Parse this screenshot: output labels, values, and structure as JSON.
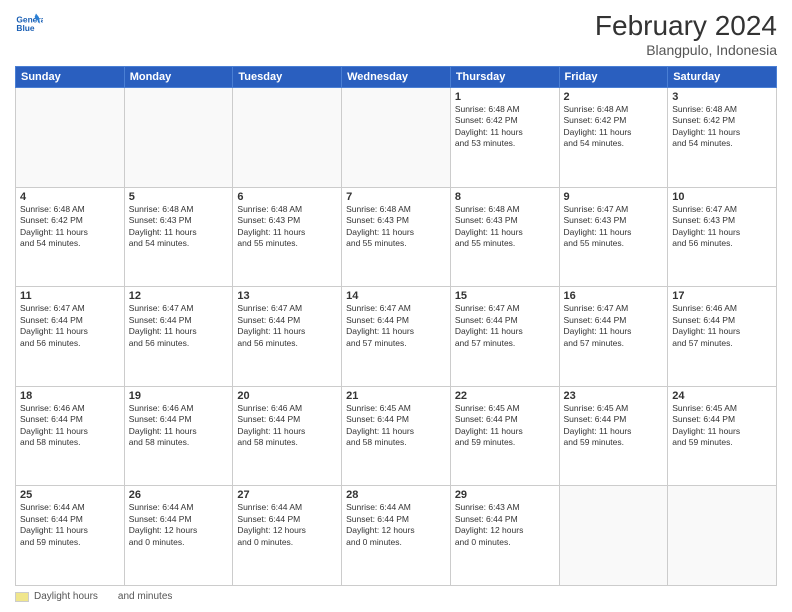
{
  "header": {
    "logo_line1": "General",
    "logo_line2": "Blue",
    "month_year": "February 2024",
    "location": "Blangpulo, Indonesia"
  },
  "days_of_week": [
    "Sunday",
    "Monday",
    "Tuesday",
    "Wednesday",
    "Thursday",
    "Friday",
    "Saturday"
  ],
  "weeks": [
    [
      {
        "day": "",
        "info": ""
      },
      {
        "day": "",
        "info": ""
      },
      {
        "day": "",
        "info": ""
      },
      {
        "day": "",
        "info": ""
      },
      {
        "day": "1",
        "info": "Sunrise: 6:48 AM\nSunset: 6:42 PM\nDaylight: 11 hours\nand 53 minutes."
      },
      {
        "day": "2",
        "info": "Sunrise: 6:48 AM\nSunset: 6:42 PM\nDaylight: 11 hours\nand 54 minutes."
      },
      {
        "day": "3",
        "info": "Sunrise: 6:48 AM\nSunset: 6:42 PM\nDaylight: 11 hours\nand 54 minutes."
      }
    ],
    [
      {
        "day": "4",
        "info": "Sunrise: 6:48 AM\nSunset: 6:42 PM\nDaylight: 11 hours\nand 54 minutes."
      },
      {
        "day": "5",
        "info": "Sunrise: 6:48 AM\nSunset: 6:43 PM\nDaylight: 11 hours\nand 54 minutes."
      },
      {
        "day": "6",
        "info": "Sunrise: 6:48 AM\nSunset: 6:43 PM\nDaylight: 11 hours\nand 55 minutes."
      },
      {
        "day": "7",
        "info": "Sunrise: 6:48 AM\nSunset: 6:43 PM\nDaylight: 11 hours\nand 55 minutes."
      },
      {
        "day": "8",
        "info": "Sunrise: 6:48 AM\nSunset: 6:43 PM\nDaylight: 11 hours\nand 55 minutes."
      },
      {
        "day": "9",
        "info": "Sunrise: 6:47 AM\nSunset: 6:43 PM\nDaylight: 11 hours\nand 55 minutes."
      },
      {
        "day": "10",
        "info": "Sunrise: 6:47 AM\nSunset: 6:43 PM\nDaylight: 11 hours\nand 56 minutes."
      }
    ],
    [
      {
        "day": "11",
        "info": "Sunrise: 6:47 AM\nSunset: 6:44 PM\nDaylight: 11 hours\nand 56 minutes."
      },
      {
        "day": "12",
        "info": "Sunrise: 6:47 AM\nSunset: 6:44 PM\nDaylight: 11 hours\nand 56 minutes."
      },
      {
        "day": "13",
        "info": "Sunrise: 6:47 AM\nSunset: 6:44 PM\nDaylight: 11 hours\nand 56 minutes."
      },
      {
        "day": "14",
        "info": "Sunrise: 6:47 AM\nSunset: 6:44 PM\nDaylight: 11 hours\nand 57 minutes."
      },
      {
        "day": "15",
        "info": "Sunrise: 6:47 AM\nSunset: 6:44 PM\nDaylight: 11 hours\nand 57 minutes."
      },
      {
        "day": "16",
        "info": "Sunrise: 6:47 AM\nSunset: 6:44 PM\nDaylight: 11 hours\nand 57 minutes."
      },
      {
        "day": "17",
        "info": "Sunrise: 6:46 AM\nSunset: 6:44 PM\nDaylight: 11 hours\nand 57 minutes."
      }
    ],
    [
      {
        "day": "18",
        "info": "Sunrise: 6:46 AM\nSunset: 6:44 PM\nDaylight: 11 hours\nand 58 minutes."
      },
      {
        "day": "19",
        "info": "Sunrise: 6:46 AM\nSunset: 6:44 PM\nDaylight: 11 hours\nand 58 minutes."
      },
      {
        "day": "20",
        "info": "Sunrise: 6:46 AM\nSunset: 6:44 PM\nDaylight: 11 hours\nand 58 minutes."
      },
      {
        "day": "21",
        "info": "Sunrise: 6:45 AM\nSunset: 6:44 PM\nDaylight: 11 hours\nand 58 minutes."
      },
      {
        "day": "22",
        "info": "Sunrise: 6:45 AM\nSunset: 6:44 PM\nDaylight: 11 hours\nand 59 minutes."
      },
      {
        "day": "23",
        "info": "Sunrise: 6:45 AM\nSunset: 6:44 PM\nDaylight: 11 hours\nand 59 minutes."
      },
      {
        "day": "24",
        "info": "Sunrise: 6:45 AM\nSunset: 6:44 PM\nDaylight: 11 hours\nand 59 minutes."
      }
    ],
    [
      {
        "day": "25",
        "info": "Sunrise: 6:44 AM\nSunset: 6:44 PM\nDaylight: 11 hours\nand 59 minutes."
      },
      {
        "day": "26",
        "info": "Sunrise: 6:44 AM\nSunset: 6:44 PM\nDaylight: 12 hours\nand 0 minutes."
      },
      {
        "day": "27",
        "info": "Sunrise: 6:44 AM\nSunset: 6:44 PM\nDaylight: 12 hours\nand 0 minutes."
      },
      {
        "day": "28",
        "info": "Sunrise: 6:44 AM\nSunset: 6:44 PM\nDaylight: 12 hours\nand 0 minutes."
      },
      {
        "day": "29",
        "info": "Sunrise: 6:43 AM\nSunset: 6:44 PM\nDaylight: 12 hours\nand 0 minutes."
      },
      {
        "day": "",
        "info": ""
      },
      {
        "day": "",
        "info": ""
      }
    ]
  ],
  "legend": {
    "daylight_label": "Daylight hours",
    "and_minutes_label": "and minutes"
  }
}
